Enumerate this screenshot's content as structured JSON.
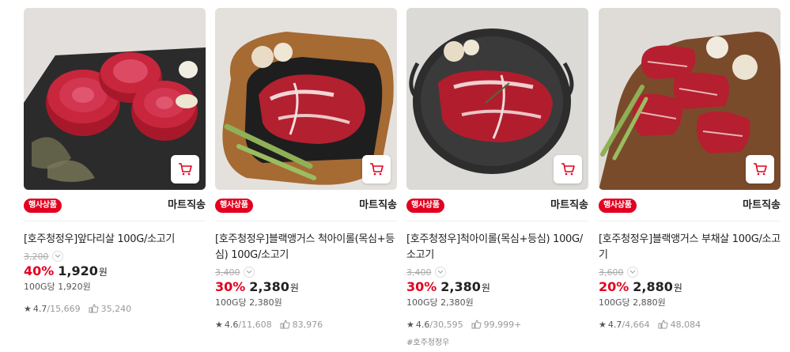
{
  "products": [
    {
      "badge": "행사상품",
      "ship_type": "마트직송",
      "name": "[호주청정우]앞다리살 100G/소고기",
      "original_price": "3,200",
      "discount": "40%",
      "sale_price": "1,920",
      "currency": "원",
      "unit_price": "100G당 1,920원",
      "rating": "4.7",
      "review_sep": "/",
      "reviews": "15,669",
      "buy_count": "35,240",
      "tag": ""
    },
    {
      "badge": "행사상품",
      "ship_type": "마트직송",
      "name": "[호주청정우]블랙앵거스 척아이롤(목심+등심) 100G/소고기",
      "original_price": "3,400",
      "discount": "30%",
      "sale_price": "2,380",
      "currency": "원",
      "unit_price": "100G당 2,380원",
      "rating": "4.6",
      "review_sep": "/",
      "reviews": "11,608",
      "buy_count": "83,976",
      "tag": ""
    },
    {
      "badge": "행사상품",
      "ship_type": "마트직송",
      "name": "[호주청정우]척아이롤(목심+등심) 100G/소고기",
      "original_price": "3,400",
      "discount": "30%",
      "sale_price": "2,380",
      "currency": "원",
      "unit_price": "100G당 2,380원",
      "rating": "4.6",
      "review_sep": "/",
      "reviews": "30,595",
      "buy_count": "99,999+",
      "tag": "#호주청정우"
    },
    {
      "badge": "행사상품",
      "ship_type": "마트직송",
      "name": "[호주청정우]블랙앵거스 부채살 100G/소고기",
      "original_price": "3,600",
      "discount": "20%",
      "sale_price": "2,880",
      "currency": "원",
      "unit_price": "100G당 2,880원",
      "rating": "4.7",
      "review_sep": "/",
      "reviews": "4,664",
      "buy_count": "48,084",
      "tag": ""
    }
  ],
  "icons": {
    "cart": "cart-icon",
    "star": "star-icon",
    "buy": "purchase-count-icon",
    "chevron": "chevron-down-icon"
  },
  "colors": {
    "accent_red": "#e3001f",
    "meat_red": "#b52033"
  }
}
